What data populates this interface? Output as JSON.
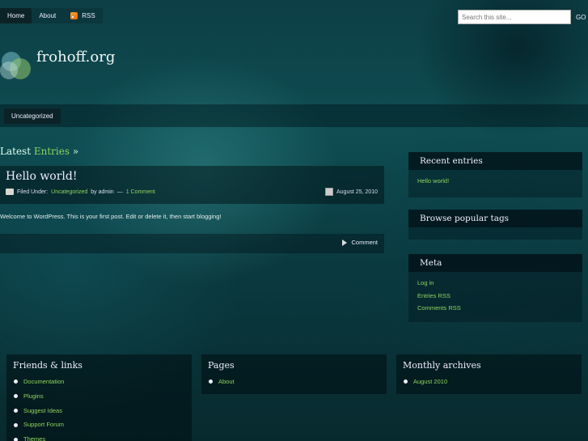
{
  "nav": {
    "items": [
      {
        "label": "Home",
        "active": true
      },
      {
        "label": "About",
        "active": false
      },
      {
        "label": "RSS",
        "active": false,
        "icon": "rss-icon"
      }
    ]
  },
  "search": {
    "placeholder": "Search this site...",
    "button": "GO"
  },
  "site": {
    "title": "frohoff.org"
  },
  "categories": [
    {
      "label": "Uncategorized"
    }
  ],
  "latest": {
    "prefix": "Latest",
    "accent": "Entries",
    "suffix": "»"
  },
  "post": {
    "title": "Hello world!",
    "filed_under": "Filed Under:",
    "category": "Uncategorized",
    "by": "by admin",
    "dash": "—",
    "comments": "1 Comment",
    "date": "August 25, 2010",
    "body": "Welcome to WordPress. This is your first post. Edit or delete it, then start blogging!",
    "comment_link": "Comment"
  },
  "sidebar": {
    "recent": {
      "title": "Recent entries",
      "items": [
        "Hello world!"
      ]
    },
    "tags": {
      "title": "Browse popular tags"
    },
    "meta": {
      "title": "Meta",
      "items": [
        "Log in",
        "Entries RSS",
        "Comments RSS"
      ]
    }
  },
  "footer": {
    "friends": {
      "title": "Friends & links",
      "items": [
        "Documentation",
        "Plugins",
        "Suggest Ideas",
        "Support Forum",
        "Themes"
      ]
    },
    "pages": {
      "title": "Pages",
      "items": [
        "About"
      ]
    },
    "archives": {
      "title": "Monthly archives",
      "items": [
        "August 2010"
      ]
    }
  },
  "colors": {
    "accent": "#8fd45c",
    "nav_active": "#0b2327"
  }
}
